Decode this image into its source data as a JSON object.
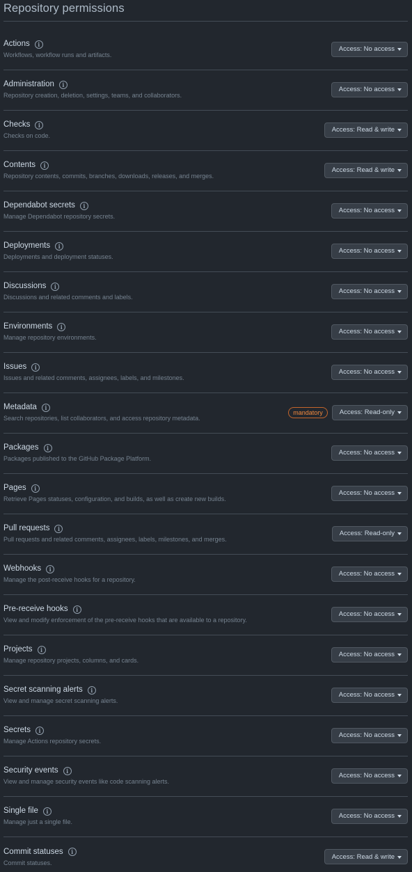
{
  "page": {
    "title": "Repository permissions"
  },
  "permissions": [
    {
      "name": "Actions",
      "desc": "Workflows, workflow runs and artifacts.",
      "access": "Access: No access",
      "badge": ""
    },
    {
      "name": "Administration",
      "desc": "Repository creation, deletion, settings, teams, and collaborators.",
      "access": "Access: No access",
      "badge": ""
    },
    {
      "name": "Checks",
      "desc": "Checks on code.",
      "access": "Access: Read & write",
      "badge": ""
    },
    {
      "name": "Contents",
      "desc": "Repository contents, commits, branches, downloads, releases, and merges.",
      "access": "Access: Read & write",
      "badge": ""
    },
    {
      "name": "Dependabot secrets",
      "desc": "Manage Dependabot repository secrets.",
      "access": "Access: No access",
      "badge": ""
    },
    {
      "name": "Deployments",
      "desc": "Deployments and deployment statuses.",
      "access": "Access: No access",
      "badge": ""
    },
    {
      "name": "Discussions",
      "desc": "Discussions and related comments and labels.",
      "access": "Access: No access",
      "badge": ""
    },
    {
      "name": "Environments",
      "desc": "Manage repository environments.",
      "access": "Access: No access",
      "badge": ""
    },
    {
      "name": "Issues",
      "desc": "Issues and related comments, assignees, labels, and milestones.",
      "access": "Access: No access",
      "badge": ""
    },
    {
      "name": "Metadata",
      "desc": "Search repositories, list collaborators, and access repository metadata.",
      "access": "Access: Read-only",
      "badge": "mandatory"
    },
    {
      "name": "Packages",
      "desc": "Packages published to the GitHub Package Platform.",
      "access": "Access: No access",
      "badge": ""
    },
    {
      "name": "Pages",
      "desc": "Retrieve Pages statuses, configuration, and builds, as well as create new builds.",
      "access": "Access: No access",
      "badge": ""
    },
    {
      "name": "Pull requests",
      "desc": "Pull requests and related comments, assignees, labels, milestones, and merges.",
      "access": "Access: Read-only",
      "badge": ""
    },
    {
      "name": "Webhooks",
      "desc": "Manage the post-receive hooks for a repository.",
      "access": "Access: No access",
      "badge": ""
    },
    {
      "name": "Pre-receive hooks",
      "desc": "View and modify enforcement of the pre-receive hooks that are available to a repository.",
      "access": "Access: No access",
      "badge": ""
    },
    {
      "name": "Projects",
      "desc": "Manage repository projects, columns, and cards.",
      "access": "Access: No access",
      "badge": ""
    },
    {
      "name": "Secret scanning alerts",
      "desc": "View and manage secret scanning alerts.",
      "access": "Access: No access",
      "badge": ""
    },
    {
      "name": "Secrets",
      "desc": "Manage Actions repository secrets.",
      "access": "Access: No access",
      "badge": ""
    },
    {
      "name": "Security events",
      "desc": "View and manage security events like code scanning alerts.",
      "access": "Access: No access",
      "badge": ""
    },
    {
      "name": "Single file",
      "desc": "Manage just a single file.",
      "access": "Access: No access",
      "badge": ""
    },
    {
      "name": "Commit statuses",
      "desc": "Commit statuses.",
      "access": "Access: Read & write",
      "badge": ""
    }
  ],
  "icons": {
    "info": "info-icon",
    "caret": "caret-down-icon",
    "info_glyph": "i"
  }
}
